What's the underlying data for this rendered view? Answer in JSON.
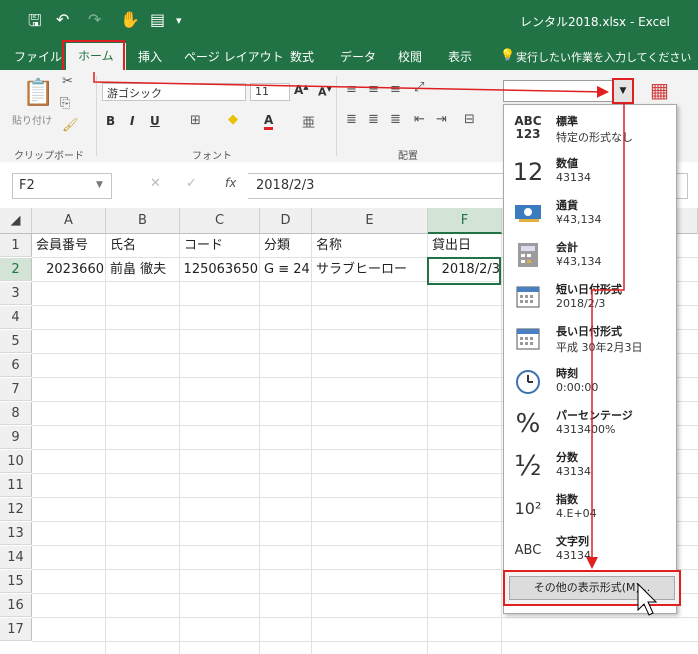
{
  "window": {
    "title": "レンタル2018.xlsx  -  Excel"
  },
  "tabs": [
    "ファイル",
    "ホーム",
    "挿入",
    "ページ レイアウト",
    "数式",
    "データ",
    "校閲",
    "表示"
  ],
  "tell_me": "実行したい作業を入力してください",
  "ribbon": {
    "paste_label": "貼り付け",
    "font_name": "游ゴシック",
    "font_size": "11",
    "bold": "B",
    "italic": "I",
    "underline": "U",
    "font_color_glyph": "A",
    "group_clipboard": "クリップボード",
    "group_font": "フォント",
    "group_alignment": "配置"
  },
  "formula_bar": {
    "name_box": "F2",
    "fx": "fx",
    "formula": "2018/2/3"
  },
  "grid": {
    "columns": [
      "A",
      "B",
      "C",
      "D",
      "E",
      "F"
    ],
    "rows": [
      "1",
      "2",
      "3",
      "4",
      "5",
      "6",
      "7",
      "8",
      "9",
      "10",
      "11",
      "12",
      "13",
      "14",
      "15",
      "16",
      "17"
    ],
    "header_row": [
      "会員番号",
      "氏名",
      "コード",
      "分類",
      "名称",
      "貸出日"
    ],
    "data_row": [
      "2023660",
      "前畠 徹夫",
      "125063650",
      "G ≡ 24",
      "サラブヒーロー",
      "2018/2/3"
    ],
    "selected_column": "F",
    "selected_row": "2"
  },
  "format_menu": {
    "items": [
      {
        "icon": "ABC\n123",
        "name": "標準",
        "sample": "特定の形式なし"
      },
      {
        "icon": "12",
        "name": "数値",
        "sample": "43134"
      },
      {
        "icon": "currency-icon",
        "name": "通貨",
        "sample": "¥43,134"
      },
      {
        "icon": "accounting-icon",
        "name": "会計",
        "sample": " ¥43,134"
      },
      {
        "icon": "calendar-icon",
        "name": "短い日付形式",
        "sample": "2018/2/3"
      },
      {
        "icon": "calendar-icon",
        "name": "長い日付形式",
        "sample": "平成 30年2月3日"
      },
      {
        "icon": "clock-icon",
        "name": "時刻",
        "sample": "0:00:00"
      },
      {
        "icon": "%",
        "name": "パーセンテージ",
        "sample": "4313400%"
      },
      {
        "icon": "½",
        "name": "分数",
        "sample": "43134"
      },
      {
        "icon": "10²",
        "name": "指数",
        "sample": "4.E+04"
      },
      {
        "icon": "ABC",
        "name": "文字列",
        "sample": "43134"
      }
    ],
    "more_label": "その他の表示形式(M)..."
  },
  "colors": {
    "excel_green": "#217346",
    "annotation_red": "#e02020"
  }
}
